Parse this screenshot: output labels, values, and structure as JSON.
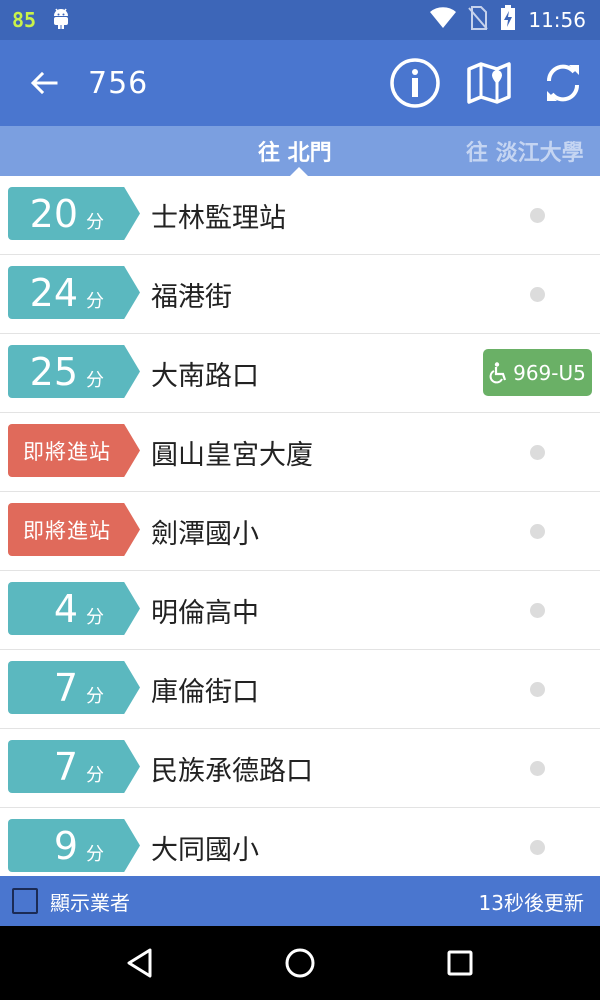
{
  "status_bar": {
    "battery_level": "85",
    "time": "11:56",
    "icons": [
      "android-icon",
      "wifi-icon",
      "no-sim-icon",
      "battery-charging-icon"
    ]
  },
  "app_bar": {
    "title": "756",
    "icons": [
      "back-arrow-icon",
      "info-icon",
      "map-icon",
      "refresh-icon"
    ]
  },
  "tabs": [
    {
      "label": "往 北門",
      "active": true
    },
    {
      "label": "往 淡江大學",
      "active": false
    }
  ],
  "stops": [
    {
      "eta_value": "20",
      "eta_unit": "分",
      "eta_text": "",
      "type": "min",
      "name": "士林監理站",
      "bus": ""
    },
    {
      "eta_value": "24",
      "eta_unit": "分",
      "eta_text": "",
      "type": "min",
      "name": "福港街",
      "bus": ""
    },
    {
      "eta_value": "25",
      "eta_unit": "分",
      "eta_text": "",
      "type": "min",
      "name": "大南路口",
      "bus": "969-U5"
    },
    {
      "eta_value": "",
      "eta_unit": "",
      "eta_text": "即將進站",
      "type": "soon",
      "name": "圓山皇宮大廈",
      "bus": ""
    },
    {
      "eta_value": "",
      "eta_unit": "",
      "eta_text": "即將進站",
      "type": "soon",
      "name": "劍潭國小",
      "bus": ""
    },
    {
      "eta_value": "4",
      "eta_unit": "分",
      "eta_text": "",
      "type": "min",
      "name": "明倫高中",
      "bus": ""
    },
    {
      "eta_value": "7",
      "eta_unit": "分",
      "eta_text": "",
      "type": "min",
      "name": "庫倫街口",
      "bus": ""
    },
    {
      "eta_value": "7",
      "eta_unit": "分",
      "eta_text": "",
      "type": "min",
      "name": "民族承德路口",
      "bus": ""
    },
    {
      "eta_value": "9",
      "eta_unit": "分",
      "eta_text": "",
      "type": "min",
      "name": "大同國小",
      "bus": ""
    }
  ],
  "footer": {
    "checkbox_label": "顯示業者",
    "checkbox_checked": false,
    "update_text": "13秒後更新"
  },
  "colors": {
    "status_bar": "#3d66b8",
    "app_bar": "#4a76cf",
    "tabs": "#7b9fe0",
    "eta_min": "#5bb8bf",
    "eta_soon": "#e06a5b",
    "bus_badge": "#6ab066"
  }
}
